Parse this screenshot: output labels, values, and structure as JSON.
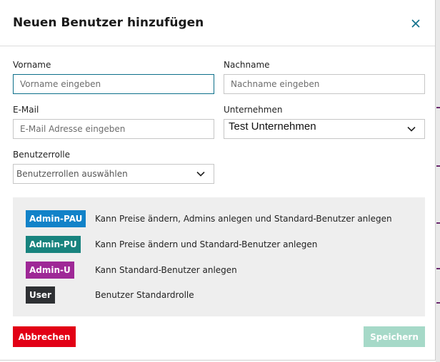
{
  "dialog": {
    "title": "Neuen Benutzer hinzufügen",
    "close_icon": "close-icon"
  },
  "form": {
    "first_name": {
      "label": "Vorname",
      "placeholder": "Vorname eingeben",
      "value": ""
    },
    "last_name": {
      "label": "Nachname",
      "placeholder": "Nachname eingeben",
      "value": ""
    },
    "email": {
      "label": "E-Mail",
      "placeholder": "E-Mail Adresse eingeben",
      "value": ""
    },
    "company": {
      "label": "Unternehmen",
      "value": "Test Unternehmen"
    },
    "role": {
      "label": "Benutzerrolle",
      "placeholder": "Benutzerrollen auswählen"
    }
  },
  "roles": [
    {
      "name": "Admin-PAU",
      "description": "Kann Preise ändern, Admins anlegen und Standard-Benutzer anlegen",
      "color": "#1282c8"
    },
    {
      "name": "Admin-PU",
      "description": "Kann Preise ändern und Standard-Benutzer anlegen",
      "color": "#18837e"
    },
    {
      "name": "Admin-U",
      "description": "Kann Standard-Benutzer anlegen",
      "color": "#9e2896"
    },
    {
      "name": "User",
      "description": "Benutzer Standardrolle",
      "color": "#2e3033"
    }
  ],
  "actions": {
    "cancel_label": "Abbrechen",
    "save_label": "Speichern"
  },
  "colors": {
    "accent": "#0d6f8a",
    "cancel": "#e20015",
    "save_disabled": "#a6d9c8"
  }
}
